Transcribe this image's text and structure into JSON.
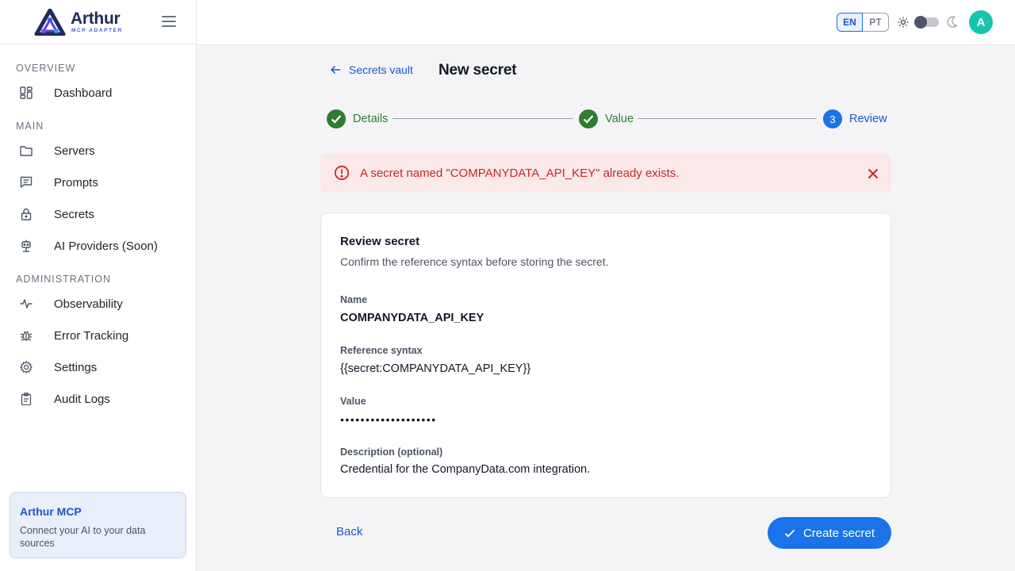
{
  "app": {
    "logo_name": "Arthur",
    "logo_sub": "MCP ADAPTER"
  },
  "sidebar": {
    "sections": [
      {
        "label": "OVERVIEW"
      },
      {
        "label": "MAIN"
      },
      {
        "label": "ADMINISTRATION"
      }
    ],
    "items": [
      {
        "label": "Dashboard",
        "icon": "dashboard-icon"
      },
      {
        "label": "Servers",
        "icon": "folder-icon"
      },
      {
        "label": "Prompts",
        "icon": "message-icon"
      },
      {
        "label": "Secrets",
        "icon": "lock-icon"
      },
      {
        "label": "AI Providers (Soon)",
        "icon": "robot-icon"
      },
      {
        "label": "Observability",
        "icon": "activity-icon"
      },
      {
        "label": "Error Tracking",
        "icon": "bug-icon"
      },
      {
        "label": "Settings",
        "icon": "gear-icon"
      },
      {
        "label": "Audit Logs",
        "icon": "clipboard-icon"
      }
    ],
    "promo": {
      "title": "Arthur MCP",
      "text": "Connect your AI to your data sources"
    }
  },
  "topbar": {
    "languages": [
      "EN",
      "PT"
    ],
    "active_language": "EN",
    "theme": "light",
    "avatar_initial": "A"
  },
  "header": {
    "back_link": "Secrets vault",
    "title": "New secret"
  },
  "stepper": {
    "steps": [
      {
        "label": "Details",
        "state": "done"
      },
      {
        "label": "Value",
        "state": "done"
      },
      {
        "label": "Review",
        "state": "active",
        "number": "3"
      }
    ]
  },
  "alert": {
    "message": "A secret named \"COMPANYDATA_API_KEY\" already exists.",
    "color": "#c62828"
  },
  "review": {
    "title": "Review secret",
    "subtitle": "Confirm the reference syntax before storing the secret.",
    "fields": [
      {
        "label": "Name",
        "value": "COMPANYDATA_API_KEY"
      },
      {
        "label": "Reference syntax",
        "value": "{{secret:COMPANYDATA_API_KEY}}"
      },
      {
        "label": "Value",
        "value": "•••••••••••••••••••"
      },
      {
        "label": "Description (optional)",
        "value": "Credential for the CompanyData.com integration."
      }
    ]
  },
  "actions": {
    "back_label": "Back",
    "create_label": "Create secret"
  },
  "colors": {
    "accent": "#1a73e8",
    "success": "#2e7d32",
    "error": "#c62828",
    "avatar": "#16c4b0"
  }
}
